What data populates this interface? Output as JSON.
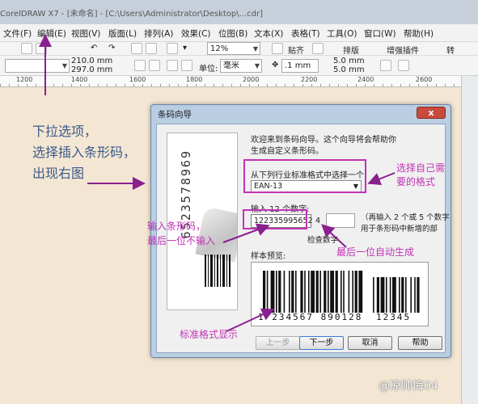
{
  "window": {
    "title": "CorelDRAW X7 - [未命名] - [C:\\Users\\Administrator\\Desktop\\...cdr]"
  },
  "menu": [
    {
      "label": "文件(F)"
    },
    {
      "label": "编辑(E)"
    },
    {
      "label": "视图(V)"
    },
    {
      "label": "版面(L)"
    },
    {
      "label": "排列(A)"
    },
    {
      "label": "效果(C)"
    },
    {
      "label": "位图(B)"
    },
    {
      "label": "文本(X)"
    },
    {
      "label": "表格(T)"
    },
    {
      "label": "工具(O)"
    },
    {
      "label": "窗口(W)"
    },
    {
      "label": "帮助(H)"
    }
  ],
  "toolbar": {
    "zoom": "12%",
    "snap_label": "贴齐",
    "typeset_label": "排版",
    "plugin_label": "增强插件",
    "convert_label": "转"
  },
  "propertybar": {
    "width": "210.0 mm",
    "height": "297.0 mm",
    "unit_label": "单位:",
    "unit": "毫米",
    "nudge": ".1 mm",
    "dup_x": "5.0 mm",
    "dup_y": "5.0 mm"
  },
  "ruler": {
    "ticks": [
      "1200",
      "1400",
      "1600",
      "1800",
      "2000",
      "2200",
      "2400",
      "2600"
    ]
  },
  "dialog": {
    "title": "条码向导",
    "close": "x",
    "intro_line1": "欢迎来到条码向导。这个向导将会帮助你",
    "intro_line2": "生成自定义条形码。",
    "select_label": "从下列行业标准格式中选择一个:",
    "format": "EAN-13",
    "input_label": "输入 12 个数字:",
    "input_value": "122335995652",
    "check_digit": "4",
    "check_label": "检查数字",
    "addon_line1": "（再输入 2 个或 5 个数字",
    "addon_line2": "用于条形码中新增的部",
    "preview_label": "样本预览:",
    "preview_main": "1 234567 890128",
    "preview_addon": "12345",
    "illus_digits": "6523578969",
    "buttons": {
      "prev": "上一步",
      "next": "下一步",
      "cancel": "取消",
      "help": "帮助"
    }
  },
  "annotations": {
    "left_line1": "下拉选项，",
    "left_line2": "选择插入条形码，",
    "left_line3": "出现右图",
    "choose_line1": "选择自己需",
    "choose_line2": "要的格式",
    "input_note1": "输入条形码，",
    "input_note2": "最后一位不输入",
    "auto_note": "最后一位自动生成",
    "standard_note": "标准格式显示"
  },
  "watermark": "@凉帅悔04",
  "colors": {
    "annotation_pink": "#c233b6",
    "annotation_blue": "#3c5a8a",
    "dialog_frame": "#b9cde3",
    "close_button": "#c84a3c"
  }
}
